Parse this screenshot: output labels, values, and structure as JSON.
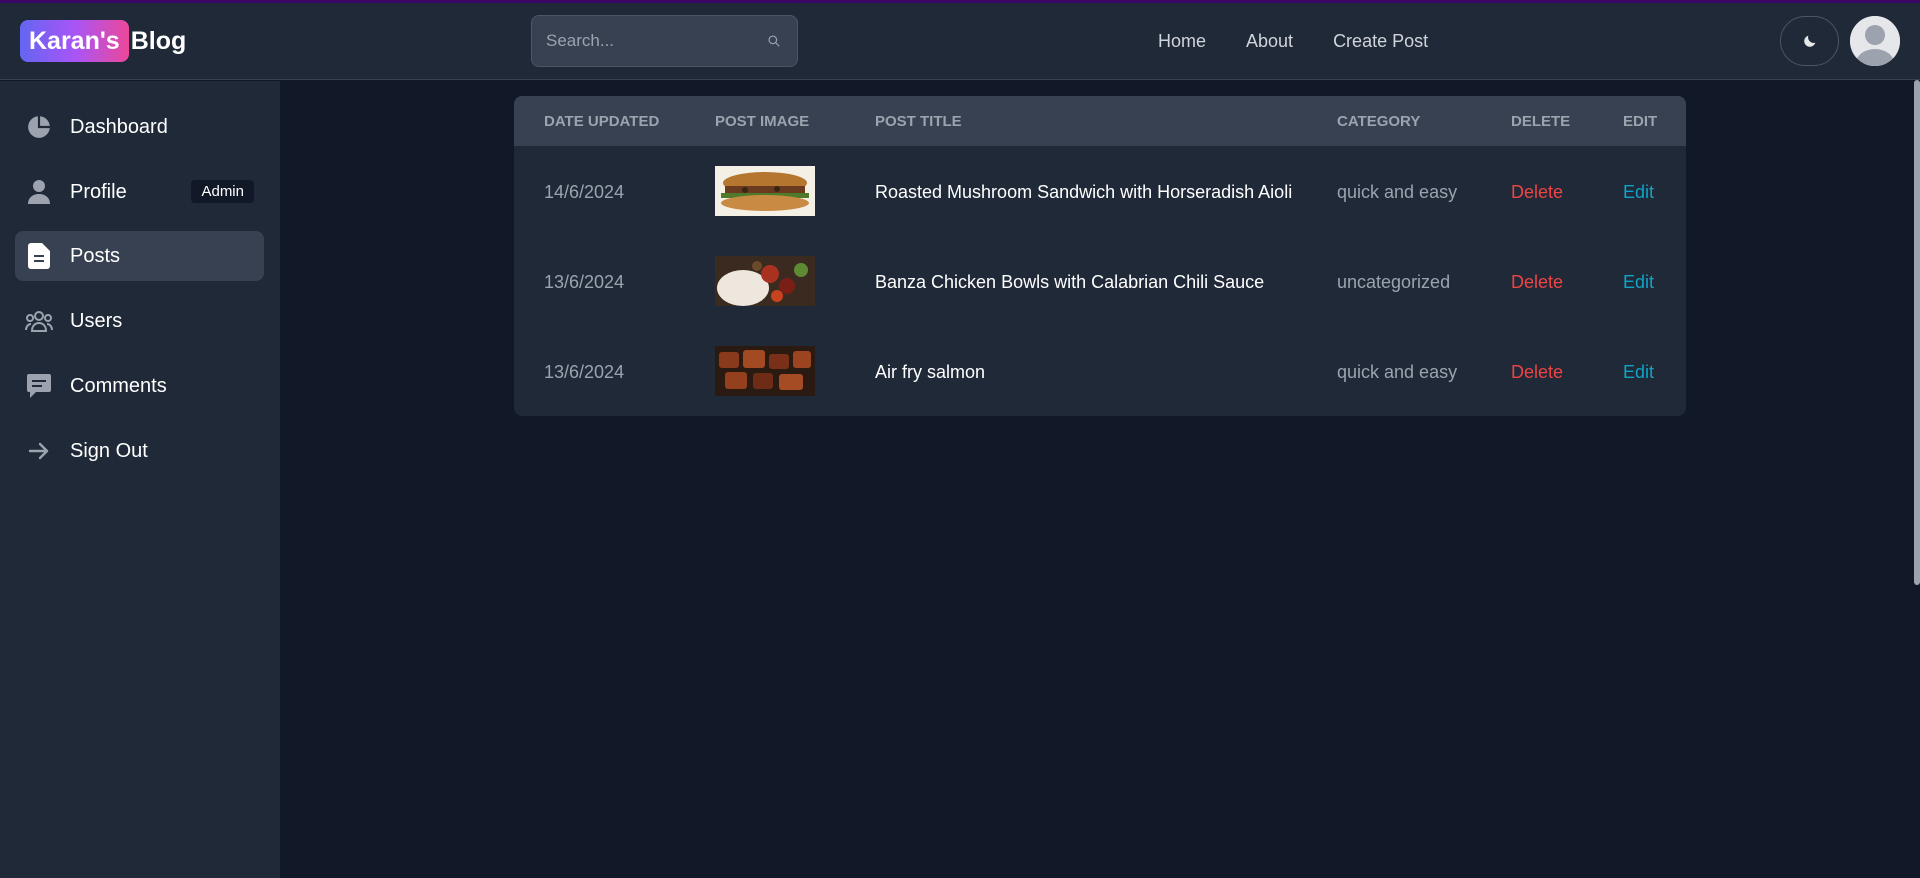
{
  "header": {
    "logo_badge": "Karan's",
    "logo_text": "Blog",
    "search_placeholder": "Search...",
    "nav": [
      "Home",
      "About",
      "Create Post"
    ],
    "theme_icon": "moon-icon",
    "avatar_icon": "user-avatar-icon"
  },
  "sidebar": {
    "items": [
      {
        "label": "Dashboard",
        "icon": "pie-chart-icon"
      },
      {
        "label": "Profile",
        "icon": "user-icon",
        "badge": "Admin"
      },
      {
        "label": "Posts",
        "icon": "document-icon",
        "active": true
      },
      {
        "label": "Users",
        "icon": "users-group-icon"
      },
      {
        "label": "Comments",
        "icon": "comment-icon"
      },
      {
        "label": "Sign Out",
        "icon": "arrow-right-icon"
      }
    ]
  },
  "table": {
    "headers": {
      "date": "Date Updated",
      "image": "Post Image",
      "title": "Post Title",
      "category": "Category",
      "delete": "Delete",
      "edit": "Edit"
    },
    "rows": [
      {
        "date": "14/6/2024",
        "title": "Roasted Mushroom Sandwich with Horseradish Aioli",
        "category": "quick and easy",
        "delete": "Delete",
        "edit": "Edit",
        "image": "sandwich-photo"
      },
      {
        "date": "13/6/2024",
        "title": "Banza Chicken Bowls with Calabrian Chili Sauce",
        "category": "uncategorized",
        "delete": "Delete",
        "edit": "Edit",
        "image": "chicken-bowl-photo"
      },
      {
        "date": "13/6/2024",
        "title": "Air fry salmon",
        "category": "quick and easy",
        "delete": "Delete",
        "edit": "Edit",
        "image": "salmon-photo"
      }
    ]
  },
  "colors": {
    "page_bg": "#111827",
    "panel_bg": "#1f2937",
    "header_row_bg": "#374151",
    "delete": "#ef4444",
    "edit": "#0ea5c6"
  }
}
